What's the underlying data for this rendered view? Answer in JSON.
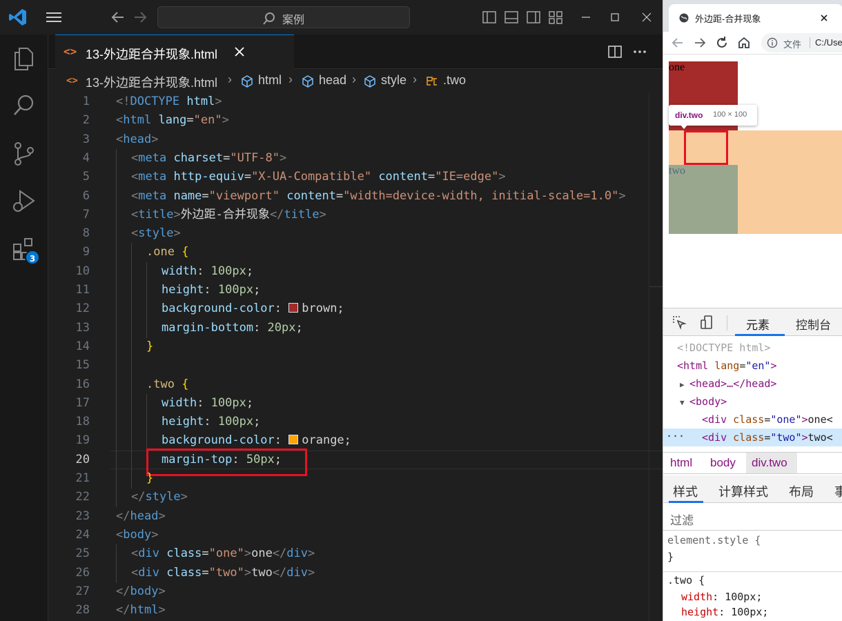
{
  "vscode": {
    "title_search": "案例",
    "tab": {
      "label": "13-外边距合并现象.html",
      "icon": "html-file-icon"
    },
    "breadcrumb": [
      "13-外边距合并现象.html",
      "html",
      "head",
      "style",
      ".two"
    ],
    "activity_badge": "3",
    "current_line": 20,
    "highlighted_line": 20,
    "code_lines": [
      {
        "n": "1",
        "tokens": [
          [
            "t-pun",
            "<!"
          ],
          [
            "t-dt",
            "DOCTYPE"
          ],
          [
            "t-txt",
            " "
          ],
          [
            "t-att",
            "html"
          ],
          [
            "t-pun",
            ">"
          ]
        ]
      },
      {
        "n": "2",
        "tokens": [
          [
            "t-pun",
            "<"
          ],
          [
            "t-tag",
            "html"
          ],
          [
            "t-txt",
            " "
          ],
          [
            "t-att",
            "lang"
          ],
          [
            "t-txt",
            "="
          ],
          [
            "t-str",
            "\"en\""
          ],
          [
            "t-pun",
            ">"
          ]
        ]
      },
      {
        "n": "3",
        "tokens": [
          [
            "t-pun",
            "<"
          ],
          [
            "t-tag",
            "head"
          ],
          [
            "t-pun",
            ">"
          ]
        ]
      },
      {
        "n": "4",
        "indent": 1,
        "tokens": [
          [
            "t-pun",
            "<"
          ],
          [
            "t-tag",
            "meta"
          ],
          [
            "t-txt",
            " "
          ],
          [
            "t-att",
            "charset"
          ],
          [
            "t-txt",
            "="
          ],
          [
            "t-str",
            "\"UTF-8\""
          ],
          [
            "t-pun",
            ">"
          ]
        ]
      },
      {
        "n": "5",
        "indent": 1,
        "tokens": [
          [
            "t-pun",
            "<"
          ],
          [
            "t-tag",
            "meta"
          ],
          [
            "t-txt",
            " "
          ],
          [
            "t-att",
            "http-equiv"
          ],
          [
            "t-txt",
            "="
          ],
          [
            "t-str",
            "\"X-UA-Compatible\""
          ],
          [
            "t-txt",
            " "
          ],
          [
            "t-att",
            "content"
          ],
          [
            "t-txt",
            "="
          ],
          [
            "t-str",
            "\"IE=edge\""
          ],
          [
            "t-pun",
            ">"
          ]
        ]
      },
      {
        "n": "6",
        "indent": 1,
        "tokens": [
          [
            "t-pun",
            "<"
          ],
          [
            "t-tag",
            "meta"
          ],
          [
            "t-txt",
            " "
          ],
          [
            "t-att",
            "name"
          ],
          [
            "t-txt",
            "="
          ],
          [
            "t-str",
            "\"viewport\""
          ],
          [
            "t-txt",
            " "
          ],
          [
            "t-att",
            "content"
          ],
          [
            "t-txt",
            "="
          ],
          [
            "t-str",
            "\"width=device-width, initial-scale=1.0\""
          ],
          [
            "t-pun",
            ">"
          ]
        ]
      },
      {
        "n": "7",
        "indent": 1,
        "tokens": [
          [
            "t-pun",
            "<"
          ],
          [
            "t-tag",
            "title"
          ],
          [
            "t-pun",
            ">"
          ],
          [
            "t-txt",
            "外边距-合并现象"
          ],
          [
            "t-pun",
            "</"
          ],
          [
            "t-tag",
            "title"
          ],
          [
            "t-pun",
            ">"
          ]
        ]
      },
      {
        "n": "8",
        "indent": 1,
        "tokens": [
          [
            "t-pun",
            "<"
          ],
          [
            "t-tag",
            "style"
          ],
          [
            "t-pun",
            ">"
          ]
        ]
      },
      {
        "n": "9",
        "indent": 2,
        "tokens": [
          [
            "t-sel",
            ".one"
          ],
          [
            "t-txt",
            " "
          ],
          [
            "t-brace",
            "{"
          ]
        ]
      },
      {
        "n": "10",
        "indent": 3,
        "tokens": [
          [
            "t-prop",
            "width"
          ],
          [
            "t-txt",
            ": "
          ],
          [
            "t-num",
            "100px"
          ],
          [
            "t-txt",
            ";"
          ]
        ]
      },
      {
        "n": "11",
        "indent": 3,
        "tokens": [
          [
            "t-prop",
            "height"
          ],
          [
            "t-txt",
            ": "
          ],
          [
            "t-num",
            "100px"
          ],
          [
            "t-txt",
            ";"
          ]
        ]
      },
      {
        "n": "12",
        "indent": 3,
        "swatch": "#a52a2a",
        "tokens": [
          [
            "t-prop",
            "background-color"
          ],
          [
            "t-txt",
            ": "
          ],
          [
            "swatch",
            ""
          ],
          [
            "t-txt",
            "brown;"
          ]
        ]
      },
      {
        "n": "13",
        "indent": 3,
        "tokens": [
          [
            "t-prop",
            "margin-bottom"
          ],
          [
            "t-txt",
            ": "
          ],
          [
            "t-num",
            "20px"
          ],
          [
            "t-txt",
            ";"
          ]
        ]
      },
      {
        "n": "14",
        "indent": 2,
        "tokens": [
          [
            "t-brace",
            "}"
          ]
        ]
      },
      {
        "n": "15",
        "indent": 2,
        "tokens": []
      },
      {
        "n": "16",
        "indent": 2,
        "tokens": [
          [
            "t-sel",
            ".two"
          ],
          [
            "t-txt",
            " "
          ],
          [
            "t-brace",
            "{"
          ]
        ]
      },
      {
        "n": "17",
        "indent": 3,
        "tokens": [
          [
            "t-prop",
            "width"
          ],
          [
            "t-txt",
            ": "
          ],
          [
            "t-num",
            "100px"
          ],
          [
            "t-txt",
            ";"
          ]
        ]
      },
      {
        "n": "18",
        "indent": 3,
        "tokens": [
          [
            "t-prop",
            "height"
          ],
          [
            "t-txt",
            ": "
          ],
          [
            "t-num",
            "100px"
          ],
          [
            "t-txt",
            ";"
          ]
        ]
      },
      {
        "n": "19",
        "indent": 3,
        "swatch": "#ffa500",
        "tokens": [
          [
            "t-prop",
            "background-color"
          ],
          [
            "t-txt",
            ": "
          ],
          [
            "swatch",
            ""
          ],
          [
            "t-txt",
            "orange;"
          ]
        ]
      },
      {
        "n": "20",
        "indent": 3,
        "tokens": [
          [
            "t-prop",
            "margin-top"
          ],
          [
            "t-txt",
            ": "
          ],
          [
            "t-num",
            "50px"
          ],
          [
            "t-txt",
            ";"
          ]
        ]
      },
      {
        "n": "21",
        "indent": 2,
        "tokens": [
          [
            "t-brace",
            "}"
          ]
        ]
      },
      {
        "n": "22",
        "indent": 1,
        "tokens": [
          [
            "t-pun",
            "</"
          ],
          [
            "t-tag",
            "style"
          ],
          [
            "t-pun",
            ">"
          ]
        ]
      },
      {
        "n": "23",
        "tokens": [
          [
            "t-pun",
            "</"
          ],
          [
            "t-tag",
            "head"
          ],
          [
            "t-pun",
            ">"
          ]
        ]
      },
      {
        "n": "24",
        "tokens": [
          [
            "t-pun",
            "<"
          ],
          [
            "t-tag",
            "body"
          ],
          [
            "t-pun",
            ">"
          ]
        ]
      },
      {
        "n": "25",
        "indent": 1,
        "tokens": [
          [
            "t-pun",
            "<"
          ],
          [
            "t-tag",
            "div"
          ],
          [
            "t-txt",
            " "
          ],
          [
            "t-att",
            "class"
          ],
          [
            "t-txt",
            "="
          ],
          [
            "t-str",
            "\"one\""
          ],
          [
            "t-pun",
            ">"
          ],
          [
            "t-txt",
            "one"
          ],
          [
            "t-pun",
            "</"
          ],
          [
            "t-tag",
            "div"
          ],
          [
            "t-pun",
            ">"
          ]
        ]
      },
      {
        "n": "26",
        "indent": 1,
        "tokens": [
          [
            "t-pun",
            "<"
          ],
          [
            "t-tag",
            "div"
          ],
          [
            "t-txt",
            " "
          ],
          [
            "t-att",
            "class"
          ],
          [
            "t-txt",
            "="
          ],
          [
            "t-str",
            "\"two\""
          ],
          [
            "t-pun",
            ">"
          ],
          [
            "t-txt",
            "two"
          ],
          [
            "t-pun",
            "</"
          ],
          [
            "t-tag",
            "div"
          ],
          [
            "t-pun",
            ">"
          ]
        ]
      },
      {
        "n": "27",
        "tokens": [
          [
            "t-pun",
            "</"
          ],
          [
            "t-tag",
            "body"
          ],
          [
            "t-pun",
            ">"
          ]
        ]
      },
      {
        "n": "28",
        "tokens": [
          [
            "t-pun",
            "</"
          ],
          [
            "t-tag",
            "html"
          ],
          [
            "t-pun",
            ">"
          ]
        ]
      }
    ]
  },
  "browser": {
    "tab_title": "外边距-合并现象",
    "omnibox_label": "文件",
    "omnibox_url": "C:/Use",
    "page": {
      "one_text": "one",
      "two_text": "two",
      "one_color": "#a52a2a",
      "two_color": "#9aa78f",
      "margin_color": "#f9cc9d"
    },
    "tooltip": {
      "name": "div.two",
      "size": "100 × 100"
    },
    "devtools": {
      "tabs": [
        "元素",
        "控制台"
      ],
      "dom": [
        {
          "kind": "doc",
          "text": "<!DOCTYPE html>"
        },
        {
          "kind": "html",
          "text_tag": "html",
          "attr": "lang",
          "val": "\"en\""
        },
        {
          "kind": "head",
          "text": "<head>…</head>"
        },
        {
          "kind": "body",
          "text": "<body>"
        },
        {
          "kind": "div",
          "attr": "class",
          "val": "\"one\"",
          "content": "one<"
        },
        {
          "kind": "div-sel",
          "attr": "class",
          "val": "\"two\"",
          "content": "two<"
        }
      ],
      "crumbs": [
        "html",
        "body",
        "div.two"
      ],
      "style_tabs": [
        "样式",
        "计算样式",
        "布局",
        "事"
      ],
      "filter_placeholder": "过滤",
      "styles": {
        "element_style": "element.style {",
        "close": "}",
        "rule_selector": ".two {",
        "props": [
          {
            "name": "width",
            "value": "100px;"
          },
          {
            "name": "height",
            "value": "100px;"
          }
        ]
      }
    }
  }
}
